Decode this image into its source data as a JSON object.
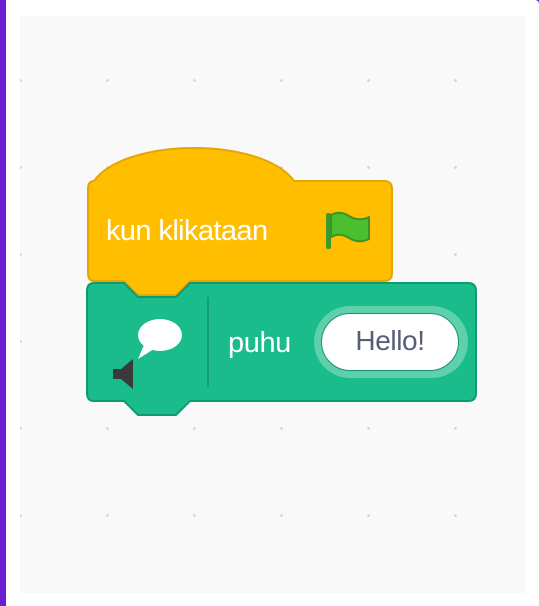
{
  "workspace": {
    "background_color": "#f9f9f9",
    "frame_color": "#6a1fd0"
  },
  "hat_block": {
    "label": "kun klikataan",
    "icon": "green-flag-icon",
    "color": "#ffbf00"
  },
  "say_block": {
    "label": "puhu",
    "icon": "speech-bubble-icon",
    "input_value": "Hello!",
    "color": "#1abc8c"
  }
}
